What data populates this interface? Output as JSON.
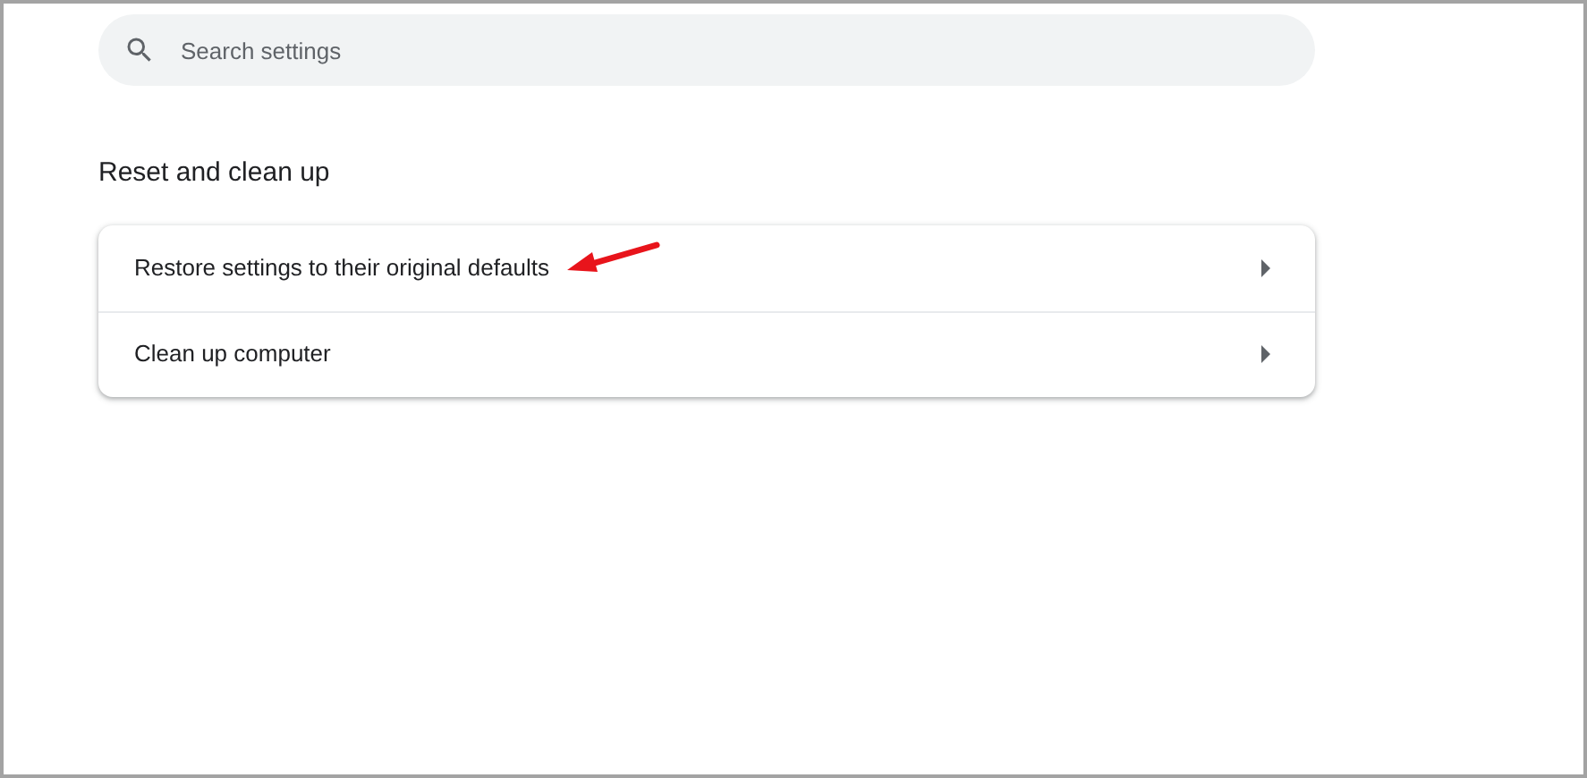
{
  "search": {
    "placeholder": "Search settings"
  },
  "section": {
    "title": "Reset and clean up"
  },
  "rows": [
    {
      "label": "Restore settings to their original defaults",
      "highlighted": true
    },
    {
      "label": "Clean up computer",
      "highlighted": false
    }
  ]
}
